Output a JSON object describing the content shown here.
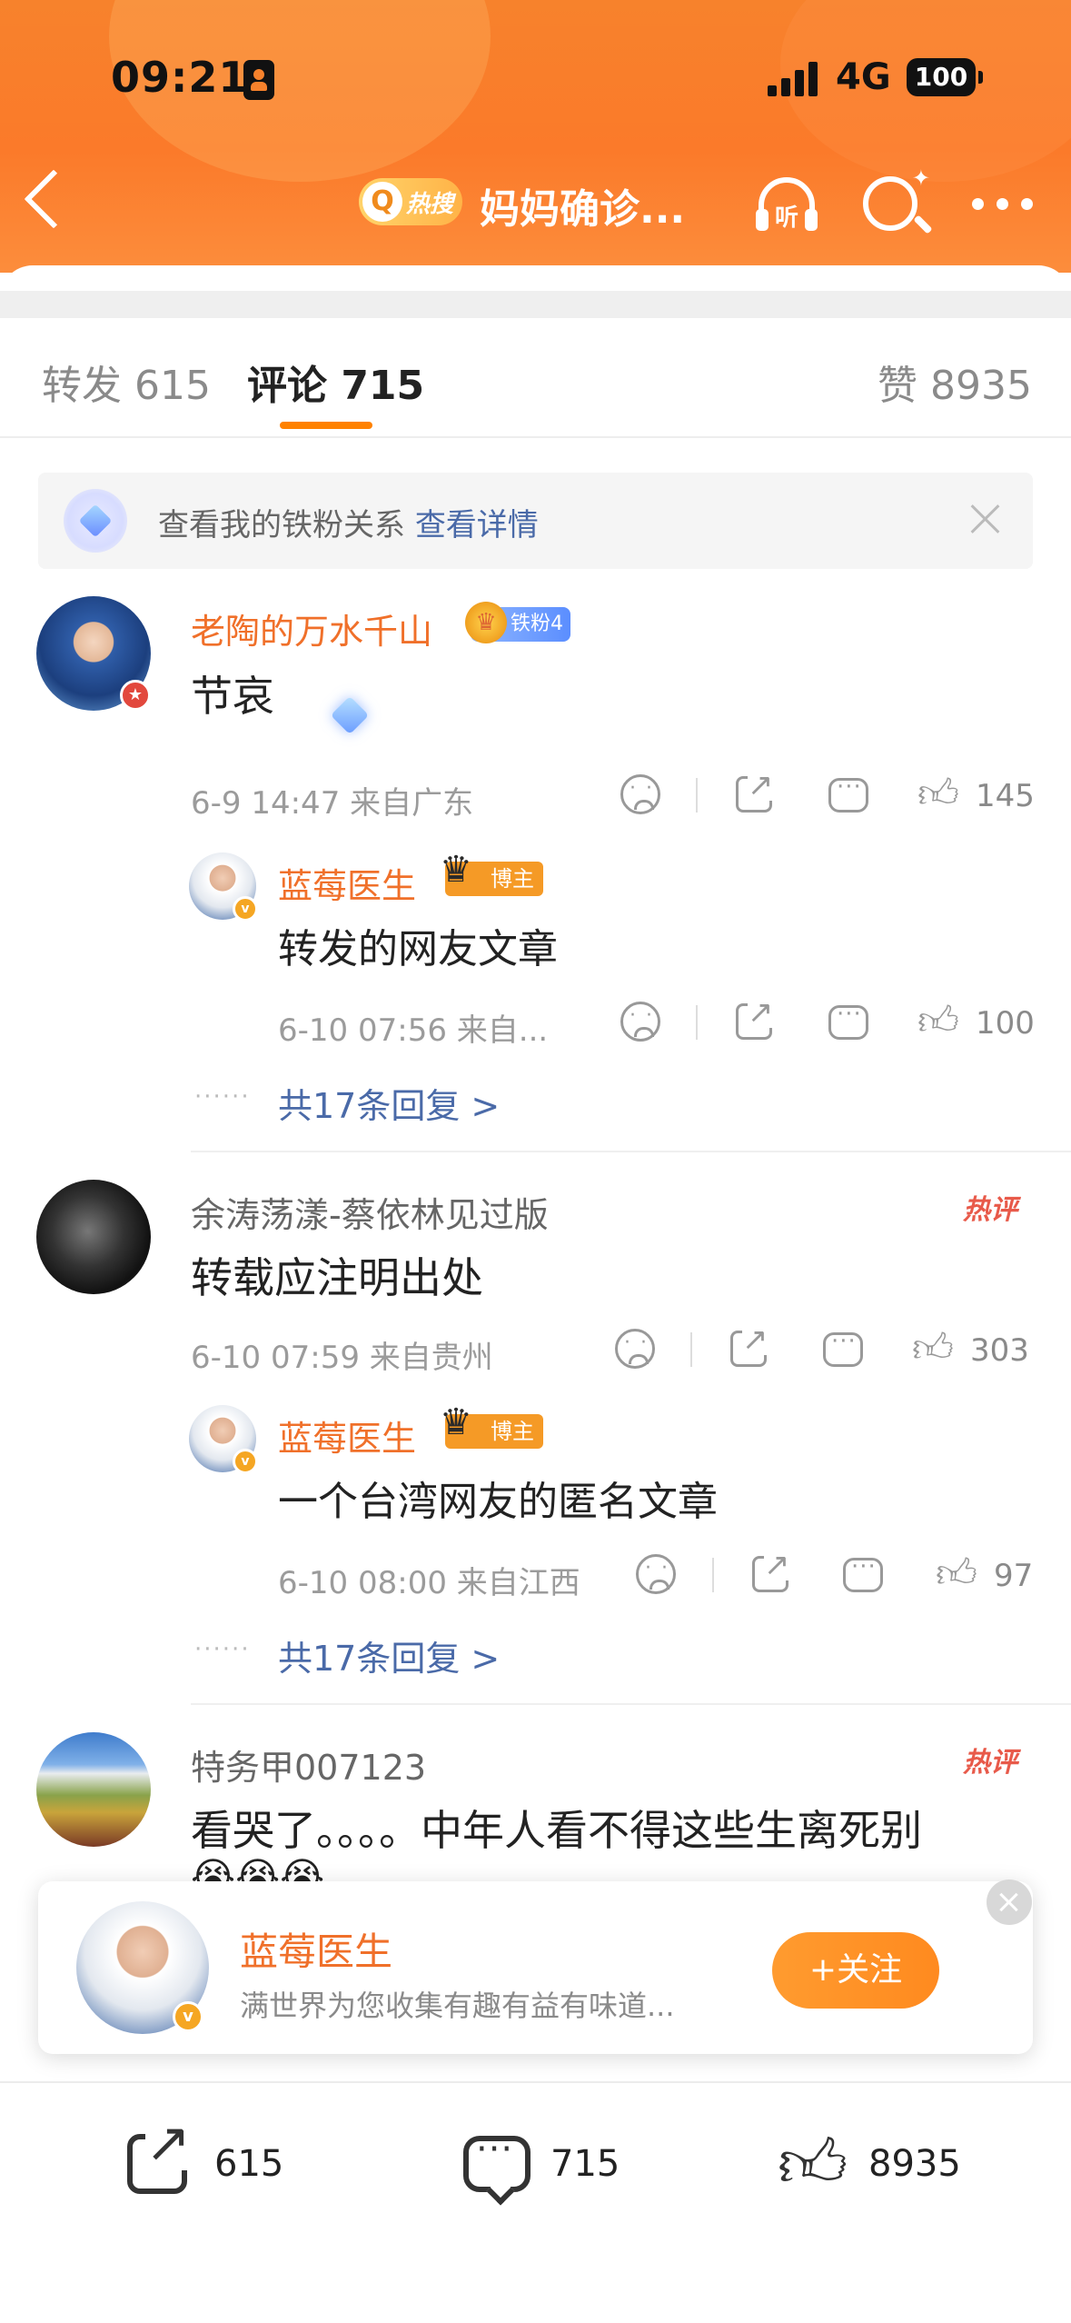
{
  "status": {
    "time": "09:21",
    "network": "4G",
    "battery": "100"
  },
  "header": {
    "hot_label": "热搜",
    "title": "妈妈确诊..."
  },
  "tabs": {
    "repost": "转发 615",
    "comment": "评论 715",
    "like": "赞 8935"
  },
  "fan_banner": {
    "text": "查看我的铁粉关系",
    "link": "查看详情"
  },
  "comments": [
    {
      "user": "老陶的万水千山",
      "badge": "铁粉4",
      "text": "节哀",
      "meta": "6-9 14:47  来自广东",
      "likes": "145",
      "reply": {
        "user": "蓝莓医生",
        "badge": "博主",
        "text": "转发的网友文章",
        "meta": "6-10 07:56  来自...",
        "likes": "100"
      },
      "more": "共17条回复 >"
    },
    {
      "user": "余涛荡漾-蔡依林见过版",
      "hot": "热评",
      "text": "转载应注明出处",
      "meta": "6-10 07:59  来自贵州",
      "likes": "303",
      "reply": {
        "user": "蓝莓医生",
        "badge": "博主",
        "text": "一个台湾网友的匿名文章",
        "meta": "6-10 08:00  来自江西",
        "likes": "97"
      },
      "more": "共17条回复 >"
    },
    {
      "user": "特务甲007123",
      "hot": "热评",
      "text": "看哭了。。。。中年人看不得这些生离死别",
      "emojis": "😭😭😭"
    }
  ],
  "follow_card": {
    "name": "蓝莓医生",
    "desc": "满世界为您收集有趣有益有味道...",
    "button": "+关注"
  },
  "bottom_bar": {
    "repost": "615",
    "comment": "715",
    "like": "8935"
  },
  "icons": [
    "back-icon",
    "search-icon",
    "listen-icon",
    "more-icon",
    "close-icon",
    "sad-icon",
    "share-icon",
    "comment-icon",
    "like-icon"
  ],
  "colors": {
    "accent": "#ff8200",
    "username": "#f0702a",
    "link": "#4a6aa8",
    "hot": "#e85a4a"
  }
}
